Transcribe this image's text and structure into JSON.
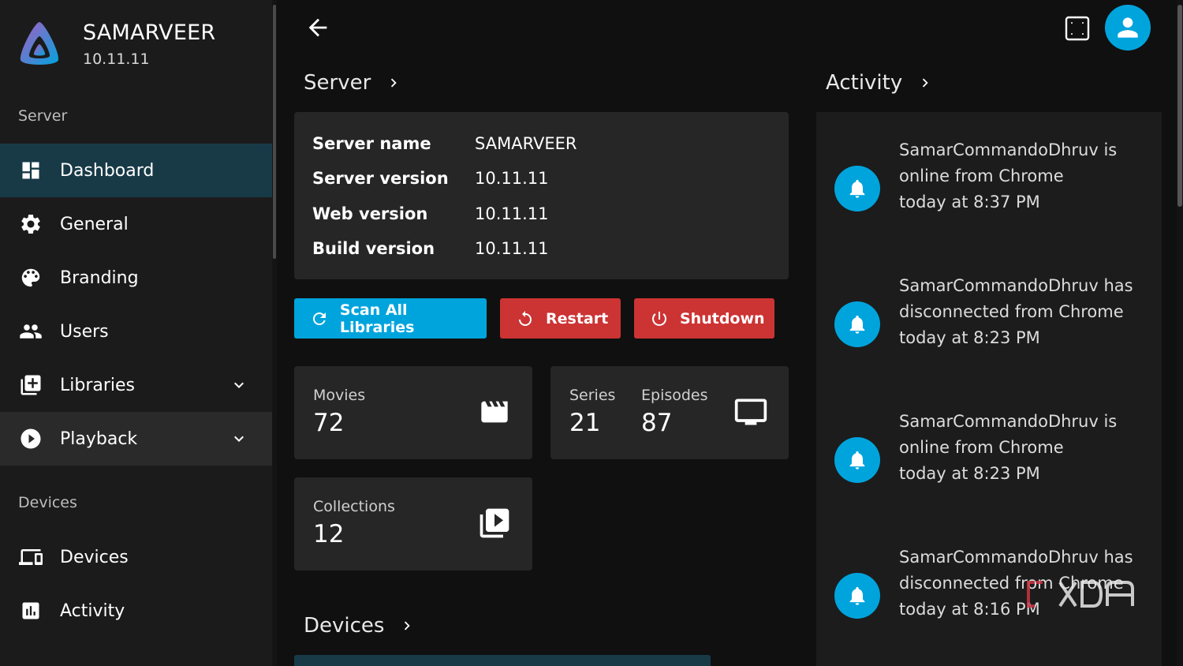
{
  "sidebar": {
    "server_name": "SAMARVEER",
    "server_version": "10.11.11",
    "section_server": "Server",
    "section_devices": "Devices",
    "items": [
      {
        "label": "Dashboard",
        "icon": "dashboard-icon",
        "state": "active"
      },
      {
        "label": "General",
        "icon": "gear-icon"
      },
      {
        "label": "Branding",
        "icon": "palette-icon"
      },
      {
        "label": "Users",
        "icon": "users-icon"
      },
      {
        "label": "Libraries",
        "icon": "library-add-icon",
        "expandable": true
      },
      {
        "label": "Playback",
        "icon": "play-circle-icon",
        "expandable": true,
        "state": "open"
      },
      {
        "label": "Devices",
        "icon": "devices-icon"
      },
      {
        "label": "Activity",
        "icon": "activity-chart-icon"
      }
    ]
  },
  "main": {
    "server_heading": "Server",
    "activity_heading": "Activity",
    "devices_heading": "Devices",
    "server_info": [
      {
        "key": "Server name",
        "value": "SAMARVEER"
      },
      {
        "key": "Server version",
        "value": "10.11.11"
      },
      {
        "key": "Web version",
        "value": "10.11.11"
      },
      {
        "key": "Build version",
        "value": "10.11.11"
      }
    ],
    "buttons": {
      "scan": "Scan All Libraries",
      "restart": "Restart",
      "shutdown": "Shutdown"
    },
    "stats": {
      "movies_label": "Movies",
      "movies_value": "72",
      "series_label": "Series",
      "series_value": "21",
      "episodes_label": "Episodes",
      "episodes_value": "87",
      "collections_label": "Collections",
      "collections_value": "12"
    }
  },
  "activity": [
    {
      "text": "SamarCommandoDhruv is online from Chrome",
      "time": "today at 8:37 PM"
    },
    {
      "text": "SamarCommandoDhruv has disconnected from Chrome",
      "time": "today at 8:23 PM"
    },
    {
      "text": "SamarCommandoDhruv is online from Chrome",
      "time": "today at 8:23 PM"
    },
    {
      "text": "SamarCommandoDhruv has disconnected from Chrome",
      "time": "today at 8:16 PM"
    }
  ],
  "colors": {
    "accent": "#00a4dc",
    "danger": "#cc3333",
    "sidebar_active": "#183a47",
    "card": "#262626"
  }
}
